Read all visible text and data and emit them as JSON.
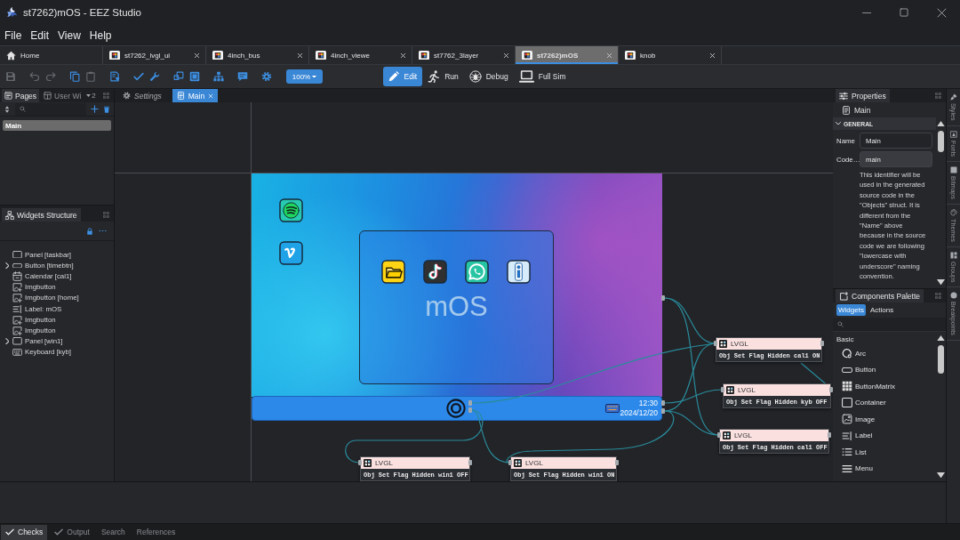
{
  "window": {
    "title": "st7262)mOS - EEZ Studio"
  },
  "menu": [
    {
      "label": "File"
    },
    {
      "label": "Edit"
    },
    {
      "label": "View"
    },
    {
      "label": "Help"
    }
  ],
  "project_tabs": [
    {
      "label": "Home",
      "kind": "home",
      "selected": false
    },
    {
      "label": "st7262_lvgl_ui",
      "kind": "project",
      "selected": false
    },
    {
      "label": "4inch_bus",
      "kind": "project",
      "selected": false
    },
    {
      "label": "4inch_viewe",
      "kind": "project",
      "selected": false
    },
    {
      "label": "st7762_3layer",
      "kind": "project",
      "selected": false
    },
    {
      "label": "st7262)mOS",
      "kind": "project",
      "selected": true
    },
    {
      "label": "knob",
      "kind": "project",
      "selected": false
    }
  ],
  "toolbar": {
    "groups": [
      [
        {
          "kind": "save",
          "disabled": true
        }
      ],
      [
        {
          "kind": "undo",
          "disabled": true
        },
        {
          "kind": "redo",
          "disabled": true
        }
      ],
      [
        {
          "kind": "copy",
          "disabled": false
        },
        {
          "kind": "paste",
          "disabled": true
        }
      ],
      [
        {
          "kind": "component",
          "disabled": false
        }
      ],
      [
        {
          "kind": "check",
          "disabled": false
        },
        {
          "kind": "wrench",
          "disabled": false
        }
      ],
      [
        {
          "kind": "frame",
          "disabled": false
        },
        {
          "kind": "frame_filled",
          "disabled": false
        }
      ],
      [
        {
          "kind": "hierarchy",
          "disabled": false
        }
      ],
      [
        {
          "kind": "comment",
          "disabled": false
        }
      ],
      [
        {
          "kind": "settings",
          "disabled": false
        }
      ]
    ],
    "zoom": "100%",
    "modes": [
      {
        "label": "Edit",
        "kind": "edit",
        "selected": true
      },
      {
        "label": "Run",
        "kind": "run",
        "selected": false
      },
      {
        "label": "Debug",
        "kind": "debug",
        "selected": false
      },
      {
        "label": "Full Sim",
        "kind": "sim",
        "selected": false
      }
    ]
  },
  "pages_panel": {
    "tabs": [
      {
        "label": "Pages",
        "kind": "pages",
        "selected": true
      },
      {
        "label": "User Wi",
        "kind": "user_widgets",
        "selected": false
      }
    ],
    "more_count": "2",
    "items": [
      {
        "label": "Main",
        "selected": true
      }
    ]
  },
  "editor_tabs": [
    {
      "label": "Settings",
      "kind": "settings",
      "selected": false,
      "preview": true
    },
    {
      "label": "Main",
      "kind": "page",
      "selected": true,
      "preview": false
    }
  ],
  "widgets_structure": {
    "title": "Widgets Structure",
    "items": [
      {
        "label": "Panel [taskbar]",
        "kind": "panel",
        "collapsed": false
      },
      {
        "label": "Button [timebtn]",
        "kind": "button",
        "collapsed": true
      },
      {
        "label": "Calendar [cal1]",
        "kind": "calendar",
        "collapsed": false
      },
      {
        "label": "Imgbutton",
        "kind": "imgbutton",
        "collapsed": false
      },
      {
        "label": "Imgbutton [home]",
        "kind": "imgbutton",
        "collapsed": false
      },
      {
        "label": "Label: mOS",
        "kind": "label",
        "collapsed": false
      },
      {
        "label": "Imgbutton",
        "kind": "imgbutton",
        "collapsed": false
      },
      {
        "label": "Imgbutton",
        "kind": "imgbutton",
        "collapsed": false
      },
      {
        "label": "Panel [win1]",
        "kind": "panel",
        "collapsed": true
      },
      {
        "label": "Keyboard [kyb]",
        "kind": "keyboard",
        "collapsed": false
      }
    ]
  },
  "screen": {
    "window_label": "mOS",
    "time": "12:30",
    "date": "2024/12/20"
  },
  "flow_nodes": [
    {
      "title": "LVGL",
      "action": "Obj Set Flag Hidden cal1 ON"
    },
    {
      "title": "LVGL",
      "action": "Obj Set Flag Hidden kyb OFF"
    },
    {
      "title": "LVGL",
      "action": "Obj Set Flag Hidden cal1 OFF"
    },
    {
      "title": "LVGL",
      "action": "Obj Set Flag Hidden win1 OFF"
    },
    {
      "title": "LVGL",
      "action": "Obj Set Flag Hidden win1 ON"
    }
  ],
  "properties": {
    "title": "Properties",
    "object": "Main",
    "section": {
      "title": "GENERAL",
      "expanded": true
    },
    "fields": [
      {
        "label": "Name",
        "value": "Main",
        "readonly": false
      },
      {
        "label": "Code…",
        "value": "main",
        "readonly": true
      }
    ],
    "description": "This identifier will be used in the generated source code in the \"Objects\" struct. It is different from the \"Name\" above because in the source code we are following \"lowercase with underscore\" naming convention."
  },
  "palette": {
    "title": "Components Palette",
    "tabs": [
      {
        "label": "Widgets",
        "selected": true
      },
      {
        "label": "Actions",
        "selected": false
      }
    ],
    "group": "Basic",
    "items": [
      {
        "label": "Arc",
        "kind": "arc"
      },
      {
        "label": "Button",
        "kind": "button"
      },
      {
        "label": "ButtonMatrix",
        "kind": "buttonmatrix"
      },
      {
        "label": "Container",
        "kind": "container"
      },
      {
        "label": "Image",
        "kind": "image"
      },
      {
        "label": "Label",
        "kind": "label"
      },
      {
        "label": "List",
        "kind": "list"
      },
      {
        "label": "Menu",
        "kind": "menu"
      }
    ]
  },
  "sidebar": [
    {
      "label": "Styles",
      "kind": "styles"
    },
    {
      "label": "Fonts",
      "kind": "fonts"
    },
    {
      "label": "Bitmaps",
      "kind": "bitmaps"
    },
    {
      "label": "Themes",
      "kind": "themes"
    },
    {
      "label": "Groups",
      "kind": "groups"
    },
    {
      "label": "Breakpoints",
      "kind": "breakpoints"
    }
  ],
  "bottom_tabs": [
    {
      "label": "Checks",
      "kind": "check",
      "selected": true
    },
    {
      "label": "Output",
      "kind": "check",
      "selected": false
    },
    {
      "label": "Search",
      "kind": "plain",
      "selected": false
    },
    {
      "label": "References",
      "kind": "plain",
      "selected": false
    }
  ]
}
